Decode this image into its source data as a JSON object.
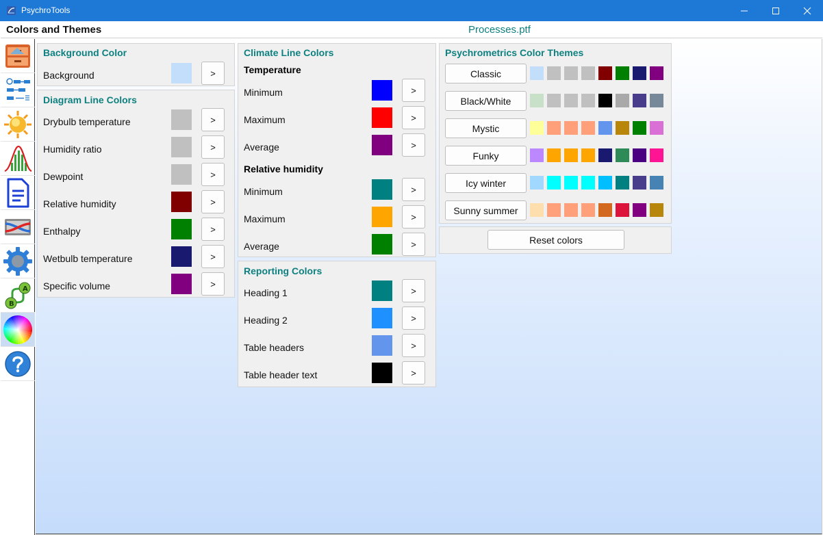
{
  "window": {
    "app_title": "PsychroTools"
  },
  "header": {
    "page_title": "Colors and Themes",
    "file_name": "Processes.ptf"
  },
  "sidebar": {
    "items": [
      {
        "icon": "cabinet-icon"
      },
      {
        "icon": "process-flow-icon"
      },
      {
        "icon": "sun-icon"
      },
      {
        "icon": "distribution-chart-icon"
      },
      {
        "icon": "document-icon"
      },
      {
        "icon": "heat-exchanger-icon"
      },
      {
        "icon": "gear-icon"
      },
      {
        "icon": "ab-compare-icon"
      },
      {
        "icon": "color-wheel-icon",
        "active": true
      },
      {
        "icon": "help-icon"
      }
    ]
  },
  "background_panel": {
    "title": "Background Color",
    "rows": [
      {
        "label": "Background",
        "color": "#c2defa",
        "button": ">"
      }
    ]
  },
  "diagram_panel": {
    "title": "Diagram Line Colors",
    "rows": [
      {
        "label": "Drybulb temperature",
        "color": "#c0c0c0",
        "button": ">"
      },
      {
        "label": "Humidity ratio",
        "color": "#c0c0c0",
        "button": ">"
      },
      {
        "label": "Dewpoint",
        "color": "#c0c0c0",
        "button": ">"
      },
      {
        "label": "Relative humidity",
        "color": "#800000",
        "button": ">"
      },
      {
        "label": "Enthalpy",
        "color": "#008000",
        "button": ">"
      },
      {
        "label": "Wetbulb temperature",
        "color": "#191970",
        "button": ">"
      },
      {
        "label": "Specific volume",
        "color": "#800080",
        "button": ">"
      }
    ]
  },
  "climate_panel": {
    "title": "Climate Line Colors",
    "temperature_heading": "Temperature",
    "temperature_rows": [
      {
        "label": "Minimum",
        "color": "#0000ff",
        "button": ">"
      },
      {
        "label": "Maximum",
        "color": "#ff0000",
        "button": ">"
      },
      {
        "label": "Average",
        "color": "#800080",
        "button": ">"
      }
    ],
    "humidity_heading": "Relative humidity",
    "humidity_rows": [
      {
        "label": "Minimum",
        "color": "#008080",
        "button": ">"
      },
      {
        "label": "Maximum",
        "color": "#ffa500",
        "button": ">"
      },
      {
        "label": "Average",
        "color": "#008000",
        "button": ">"
      }
    ]
  },
  "reporting_panel": {
    "title": "Reporting Colors",
    "rows": [
      {
        "label": "Heading 1",
        "color": "#008080",
        "button": ">"
      },
      {
        "label": "Heading 2",
        "color": "#1e90ff",
        "button": ">"
      },
      {
        "label": "Table headers",
        "color": "#6495ed",
        "button": ">"
      },
      {
        "label": "Table header text",
        "color": "#000000",
        "button": ">"
      }
    ]
  },
  "themes_panel": {
    "title": "Psychrometrics Color Themes",
    "themes": [
      {
        "name": "Classic",
        "colors": [
          "#c2defa",
          "#c0c0c0",
          "#c0c0c0",
          "#c0c0c0",
          "#800000",
          "#008000",
          "#191970",
          "#800080"
        ]
      },
      {
        "name": "Black/White",
        "colors": [
          "#c8e0c8",
          "#c0c0c0",
          "#c0c0c0",
          "#c0c0c0",
          "#000000",
          "#a9a9a9",
          "#483d8b",
          "#778899"
        ]
      },
      {
        "name": "Mystic",
        "colors": [
          "#ffff99",
          "#ffa07a",
          "#ffa07a",
          "#ffa07a",
          "#6495ed",
          "#b8860b",
          "#008000",
          "#da70d6"
        ]
      },
      {
        "name": "Funky",
        "colors": [
          "#bb88ff",
          "#ffa500",
          "#ffa500",
          "#ffa500",
          "#191970",
          "#2e8b57",
          "#4b0082",
          "#ff1493"
        ]
      },
      {
        "name": "Icy winter",
        "colors": [
          "#a0d8ff",
          "#00ffff",
          "#00ffff",
          "#00ffff",
          "#00bfff",
          "#008080",
          "#483d8b",
          "#4682b4"
        ]
      },
      {
        "name": "Sunny summer",
        "colors": [
          "#ffdead",
          "#ffa07a",
          "#ffa07a",
          "#ffa07a",
          "#d2691e",
          "#dc143c",
          "#800080",
          "#b8860b"
        ]
      }
    ]
  },
  "reset": {
    "label": "Reset colors"
  }
}
